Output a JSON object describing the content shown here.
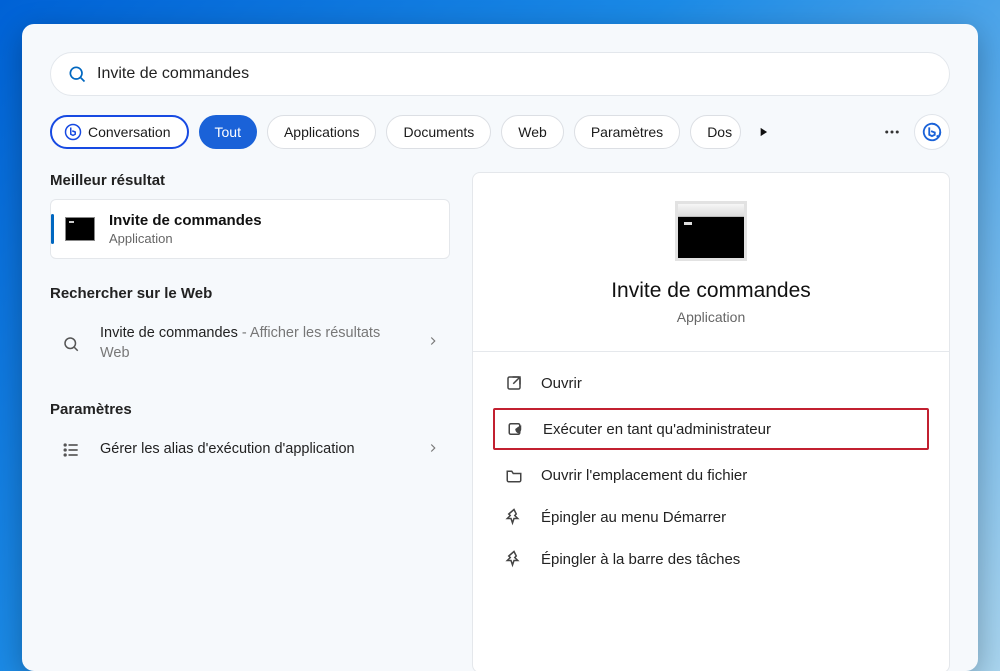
{
  "search": {
    "value": "Invite de commandes"
  },
  "filters": {
    "conversation": "Conversation",
    "all": "Tout",
    "apps": "Applications",
    "docs": "Documents",
    "web": "Web",
    "settings": "Paramètres",
    "more_cut": "Dos"
  },
  "left": {
    "best_header": "Meilleur résultat",
    "best": {
      "title": "Invite de commandes",
      "subtitle": "Application"
    },
    "web_header": "Rechercher sur le Web",
    "web_item": {
      "title": "Invite de commandes",
      "suffix": " - Afficher les résultats Web"
    },
    "settings_header": "Paramètres",
    "settings_item": {
      "title": "Gérer les alias d'exécution d'application"
    }
  },
  "right": {
    "title": "Invite de commandes",
    "subtitle": "Application",
    "actions": {
      "open": "Ouvrir",
      "run_admin": "Exécuter en tant qu'administrateur",
      "open_loc": "Ouvrir l'emplacement du fichier",
      "pin_start": "Épingler au menu Démarrer",
      "pin_task": "Épingler à la barre des tâches"
    }
  }
}
